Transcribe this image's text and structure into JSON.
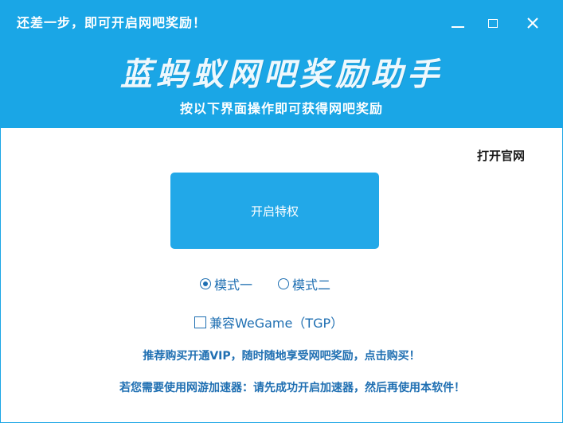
{
  "window": {
    "title": "还差一步，即可开启网吧奖励！",
    "minimize_icon": "minimize-icon",
    "maximize_icon": "maximize-icon",
    "close_icon": "close-icon",
    "close_glyph": "✕"
  },
  "header": {
    "app_title": "蓝蚂蚁网吧奖励助手",
    "subtitle": "按以下界面操作即可获得网吧奖励",
    "background_color": "#1aa6e6"
  },
  "official_site_link": "打开官网",
  "main_button": {
    "label": "开启特权",
    "color": "#22a8e8"
  },
  "modes": {
    "options": [
      {
        "label": "模式一",
        "selected": true
      },
      {
        "label": "模式二",
        "selected": false
      }
    ]
  },
  "compat": {
    "label": "兼容WeGame（TGP）",
    "checked": false
  },
  "promo_text": "推荐购买开通VIP，随时随地享受网吧奖励，点击购买！",
  "tip_text": "若您需要使用网游加速器：请先成功开启加速器，然后再使用本软件！",
  "text_color": "#1f6fb2"
}
